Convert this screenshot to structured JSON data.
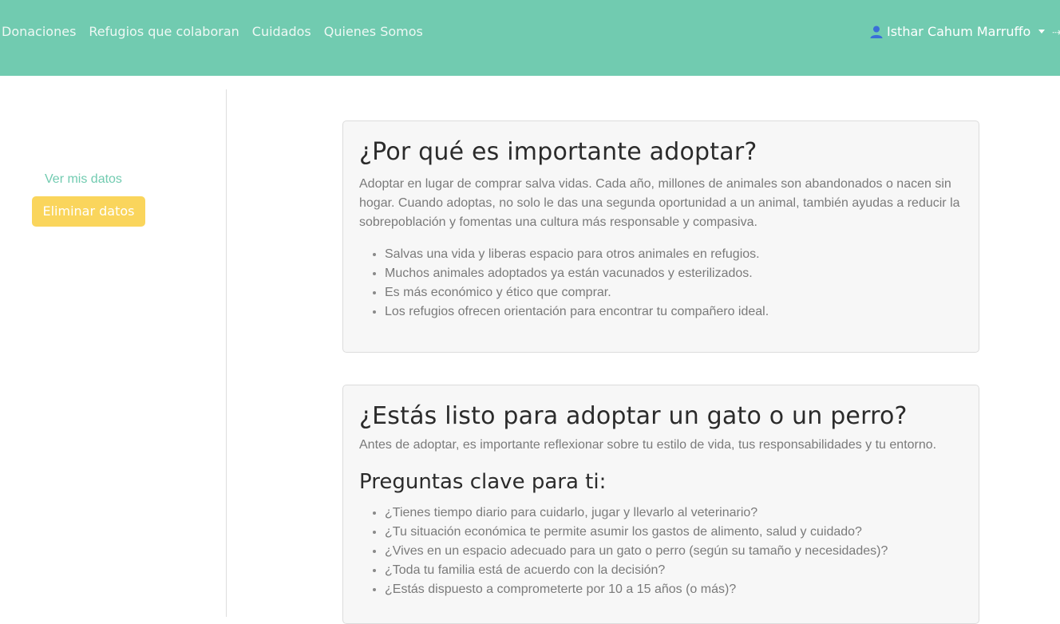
{
  "navbar": {
    "links": [
      "Donaciones",
      "Refugios que colaboran",
      "Cuidados",
      "Quienes Somos"
    ],
    "user_name": "Isthar Cahum Marruffo",
    "background": "#71cbb0"
  },
  "sidebar": {
    "view_data_link": "Ver mis datos",
    "delete_data_button": "Eliminar datos",
    "button_color": "#fad55c"
  },
  "section_adopt": {
    "title": "¿Por qué es importante adoptar?",
    "intro": "Adoptar en lugar de comprar salva vidas. Cada año, millones de animales son abandonados o nacen sin hogar. Cuando adoptas, no solo le das una segunda oportunidad a un animal, también ayudas a reducir la sobrepoblación y fomentas una cultura más responsable y compasiva.",
    "items": [
      "Salvas una vida y liberas espacio para otros animales en refugios.",
      "Muchos animales adoptados ya están vacunados y esterilizados.",
      "Es más económico y ético que comprar.",
      "Los refugios ofrecen orientación para encontrar tu compañero ideal."
    ]
  },
  "section_ready": {
    "title": "¿Estás listo para adoptar un gato o un perro?",
    "intro": "Antes de adoptar, es importante reflexionar sobre tu estilo de vida, tus responsabilidades y tu entorno.",
    "subtitle": "Preguntas clave para ti:",
    "questions": [
      "¿Tienes tiempo diario para cuidarlo, jugar y llevarlo al veterinario?",
      "¿Tu situación económica te permite asumir los gastos de alimento, salud y cuidado?",
      "¿Vives en un espacio adecuado para un gato o perro (según su tamaño y necesidades)?",
      "¿Toda tu familia está de acuerdo con la decisión?",
      "¿Estás dispuesto a comprometerte por 10 a 15 años (o más)?"
    ]
  }
}
